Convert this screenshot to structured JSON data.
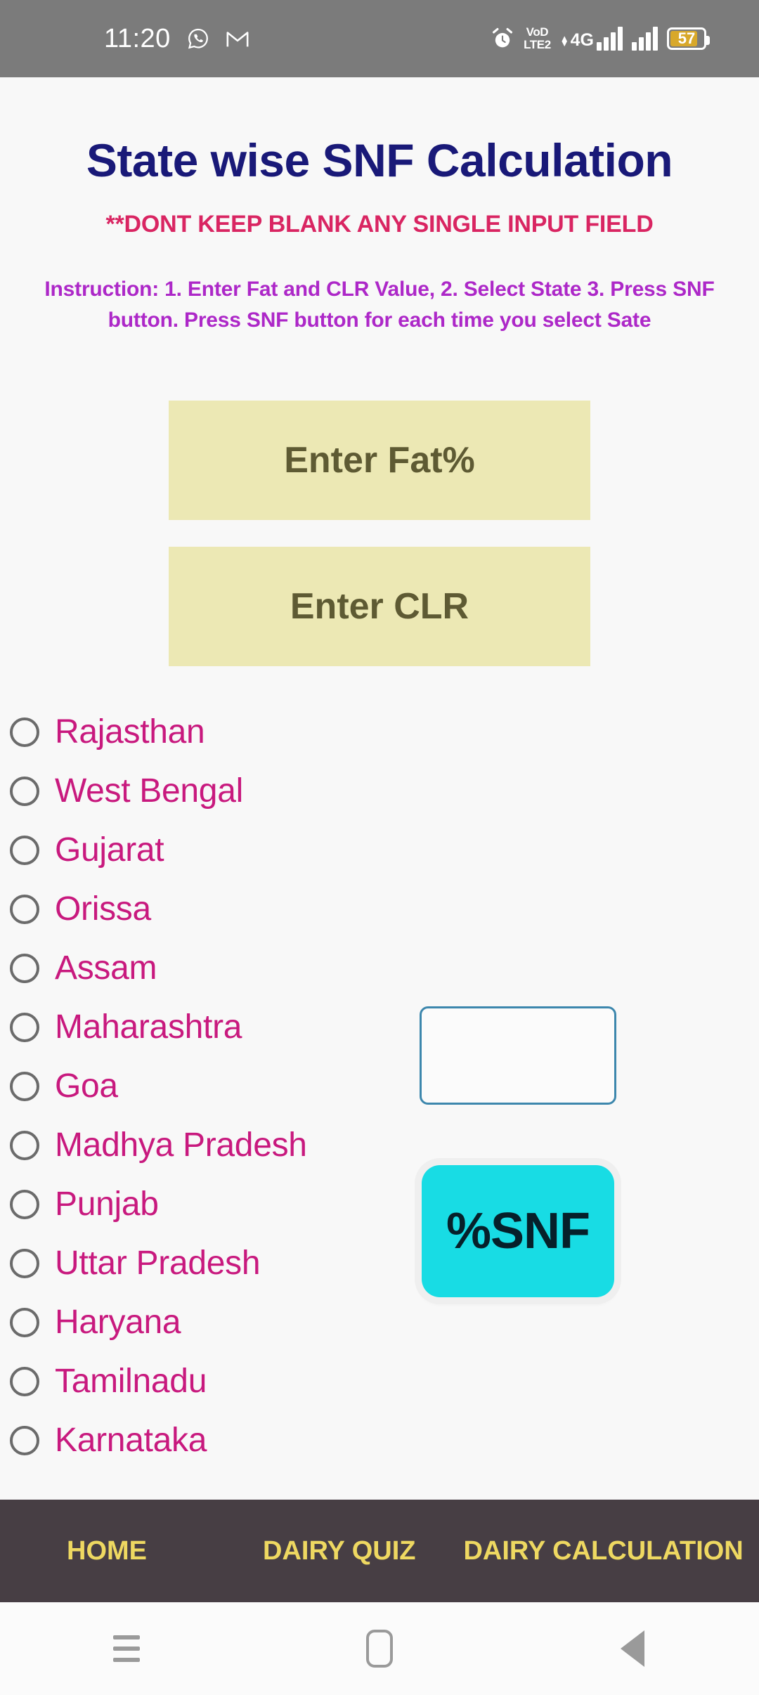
{
  "status_bar": {
    "time": "11:20",
    "icons": [
      "whatsapp-icon",
      "gmail-icon",
      "alarm-icon"
    ],
    "volte_line1": "VoD",
    "volte_line2": "LTE2",
    "network_label": "4G",
    "battery_percent": "57"
  },
  "header": {
    "title": "State wise SNF Calculation",
    "warning": "**DONT KEEP BLANK ANY SINGLE INPUT FIELD",
    "instruction": "Instruction: 1. Enter Fat and CLR Value, 2. Select State 3. Press SNF button. Press SNF button for each time you select Sate"
  },
  "inputs": {
    "fat": {
      "placeholder": "Enter Fat%",
      "value": ""
    },
    "clr": {
      "placeholder": "Enter CLR",
      "value": ""
    }
  },
  "states": [
    {
      "label": "Rajasthan",
      "selected": false
    },
    {
      "label": "West Bengal",
      "selected": false
    },
    {
      "label": "Gujarat",
      "selected": false
    },
    {
      "label": "Orissa",
      "selected": false
    },
    {
      "label": "Assam",
      "selected": false
    },
    {
      "label": "Maharashtra",
      "selected": false
    },
    {
      "label": "Goa",
      "selected": false
    },
    {
      "label": "Madhya Pradesh",
      "selected": false
    },
    {
      "label": "Punjab",
      "selected": false
    },
    {
      "label": "Uttar Pradesh",
      "selected": false
    },
    {
      "label": "Haryana",
      "selected": false
    },
    {
      "label": "Tamilnadu",
      "selected": false
    },
    {
      "label": "Karnataka",
      "selected": false
    }
  ],
  "result": {
    "value": "",
    "placeholder": ""
  },
  "snf_button": {
    "label": "%SNF"
  },
  "app_nav": {
    "home": "HOME",
    "quiz": "DAIRY QUIZ",
    "calculation": "DAIRY CALCULATION"
  },
  "system_nav": {
    "recents": "recents-icon",
    "home": "home-icon",
    "back": "back-icon"
  },
  "colors": {
    "title": "#191978",
    "warning": "#D92562",
    "instruction": "#AD28C8",
    "input_bg": "#ECE8B4",
    "state_label": "#C8197E",
    "snf_button": "#18DCE4",
    "nav_bg": "#473E44",
    "nav_text": "#EED861",
    "result_border": "#3D87AD",
    "status_bar_bg": "#7B7B7B",
    "page_bg": "#F8F8F8"
  }
}
